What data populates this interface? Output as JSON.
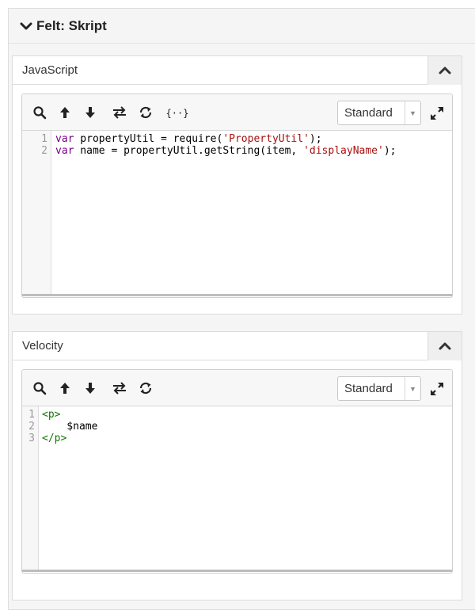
{
  "section": {
    "title": "Felt: Skript"
  },
  "panels": [
    {
      "title": "JavaScript",
      "mode": "Standard",
      "line_numbers": [
        "1",
        "2"
      ],
      "code": [
        [
          {
            "t": "var",
            "c": "kw"
          },
          {
            "t": " propertyUtil = require(",
            "c": ""
          },
          {
            "t": "'PropertyUtil'",
            "c": "str"
          },
          {
            "t": ");",
            "c": ""
          }
        ],
        [
          {
            "t": "var",
            "c": "kw"
          },
          {
            "t": " name = propertyUtil.getString(item, ",
            "c": ""
          },
          {
            "t": "'displayName'",
            "c": "str"
          },
          {
            "t": ");",
            "c": ""
          }
        ]
      ],
      "braces_label": "{··}"
    },
    {
      "title": "Velocity",
      "mode": "Standard",
      "line_numbers": [
        "1",
        "2",
        "3"
      ],
      "code": [
        [
          {
            "t": "<p>",
            "c": "tag"
          }
        ],
        [
          {
            "t": "    $name",
            "c": ""
          }
        ],
        [
          {
            "t": "</p>",
            "c": "tag"
          }
        ]
      ]
    }
  ],
  "icons": {
    "section_toggle": "chevron-down-icon",
    "collapse": "chevron-up-icon",
    "search": "search-icon",
    "up": "arrow-up-icon",
    "down": "arrow-down-icon",
    "replace": "swap-icon",
    "reload": "refresh-icon",
    "format": "braces-icon",
    "expand": "expand-icon"
  }
}
